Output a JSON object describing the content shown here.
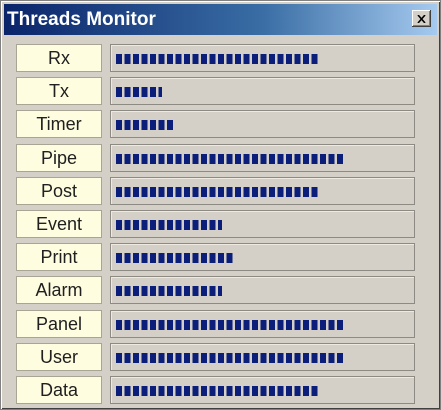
{
  "window": {
    "title": "Threads Monitor",
    "close_icon": "close-icon"
  },
  "colors": {
    "titlebar_start": "#0a246a",
    "titlebar_end": "#a6caf0",
    "label_bg": "#fffde0",
    "bar_fill": "#0a1e7a",
    "window_bg": "#d4d0c8"
  },
  "threads": [
    {
      "name": "Rx",
      "segments": 17
    },
    {
      "name": "Tx",
      "segments": 4
    },
    {
      "name": "Timer",
      "segments": 5
    },
    {
      "name": "Pipe",
      "segments": 19
    },
    {
      "name": "Post",
      "segments": 17
    },
    {
      "name": "Event",
      "segments": 9
    },
    {
      "name": "Print",
      "segments": 10
    },
    {
      "name": "Alarm",
      "segments": 9
    },
    {
      "name": "Panel",
      "segments": 19
    },
    {
      "name": "User",
      "segments": 19
    },
    {
      "name": "Data",
      "segments": 17
    }
  ]
}
